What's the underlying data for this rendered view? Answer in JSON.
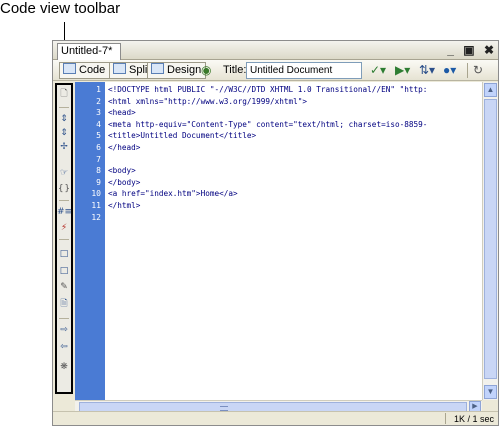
{
  "callout": {
    "label": "Code view toolbar"
  },
  "document": {
    "tab_label": "Untitled-7*"
  },
  "window_controls": {
    "minimize": "_",
    "restore": "▣",
    "close": "✖"
  },
  "toolbar": {
    "code_label": "Code",
    "split_label": "Split",
    "design_label": "Design",
    "title_label": "Title:",
    "title_value": "Untitled Document",
    "icons": [
      "check-page-icon",
      "validate-icon",
      "file-management-icon",
      "preview-browser-icon",
      "refresh-icon"
    ]
  },
  "coding_toolbar": {
    "buttons": [
      "open-documents-icon",
      "collapse-full-tag-icon",
      "collapse-selection-icon",
      "expand-all-icon",
      "select-parent-tag-icon",
      "balance-braces-icon",
      "line-numbers-icon",
      "highlight-invalid-code-icon",
      "apply-comment-icon",
      "remove-comment-icon",
      "wrap-tag-icon",
      "recent-snippets-icon",
      "indent-code-icon",
      "outdent-code-icon",
      "format-source-code-icon"
    ]
  },
  "code": {
    "line_numbers": [
      "1",
      "2",
      "3",
      "4",
      "5",
      "6",
      "7",
      "8",
      "9",
      "10",
      "11",
      "12"
    ],
    "lines": [
      "<!DOCTYPE html PUBLIC \"-//W3C//DTD XHTML 1.0 Transitional//EN\" \"http:",
      "<html xmlns=\"http://www.w3.org/1999/xhtml\">",
      "<head>",
      "<meta http-equiv=\"Content-Type\" content=\"text/html; charset=iso-8859-",
      "<title>Untitled Document</title>",
      "</head>",
      "",
      "<body>",
      "</body>",
      "<a href=\"index.htm\">Home</a>",
      "</html>",
      ""
    ]
  },
  "status": {
    "text": "1K / 1 sec"
  }
}
